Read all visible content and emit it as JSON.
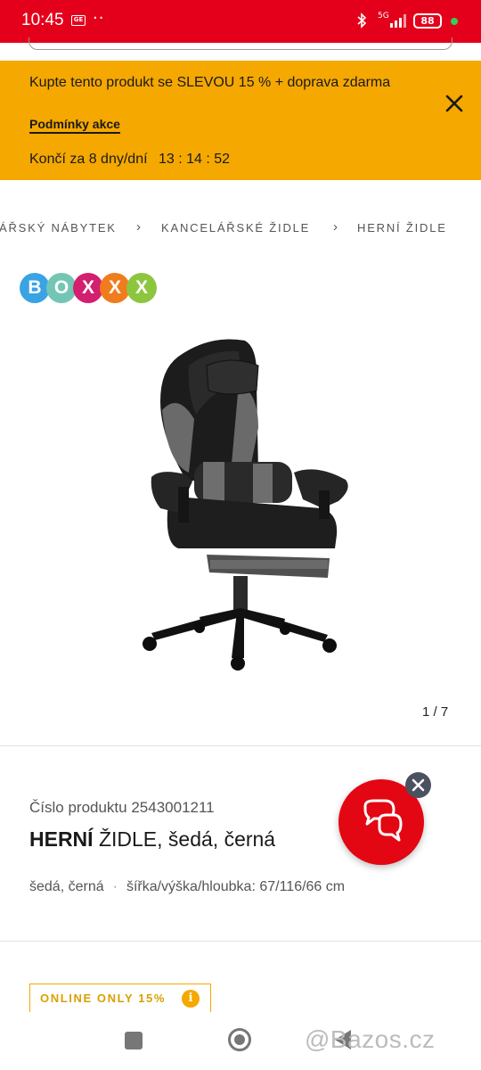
{
  "status_bar": {
    "time": "10:45",
    "network": "5G",
    "battery": "88"
  },
  "promo": {
    "text": "Kupte tento produkt se SLEVOU 15 % + doprava zdarma",
    "terms_link": "Podmínky akce",
    "ends_label": "Končí za 8 dny/dní",
    "timer": "13 : 14 : 52",
    "close_icon": "close-icon"
  },
  "breadcrumb": {
    "items": [
      "ŘSKÝ NÁBYTEK",
      "KANCELÁŘSKÉ ŽIDLE",
      "HERNÍ ŽIDLE"
    ],
    "first_item_prefix": "Á"
  },
  "brand": {
    "letters": [
      "B",
      "O",
      "X",
      "X",
      "X"
    ],
    "colors": [
      "#3aa3e3",
      "#74c6b4",
      "#d21f6f",
      "#f07c1d",
      "#8cc63f"
    ]
  },
  "gallery": {
    "counter": "1 / 7"
  },
  "product": {
    "number_label": "Číslo produktu 2543001211",
    "title_bold": "HERNÍ",
    "title_rest": " ŽIDLE, šedá, černá",
    "attr_color": "šedá, černá",
    "attr_dimensions": "šířka/výška/hloubka: 67/116/66 cm"
  },
  "badges": {
    "online_only": "ONLINE ONLY 15%",
    "info": "i"
  },
  "chat": {
    "icon": "chat-icon",
    "close_icon": "close-icon"
  },
  "watermark": "@Bazos.cz",
  "colors": {
    "status_bar": "#e4001b",
    "promo_bg": "#f5a800",
    "chat_button": "#e30613"
  }
}
